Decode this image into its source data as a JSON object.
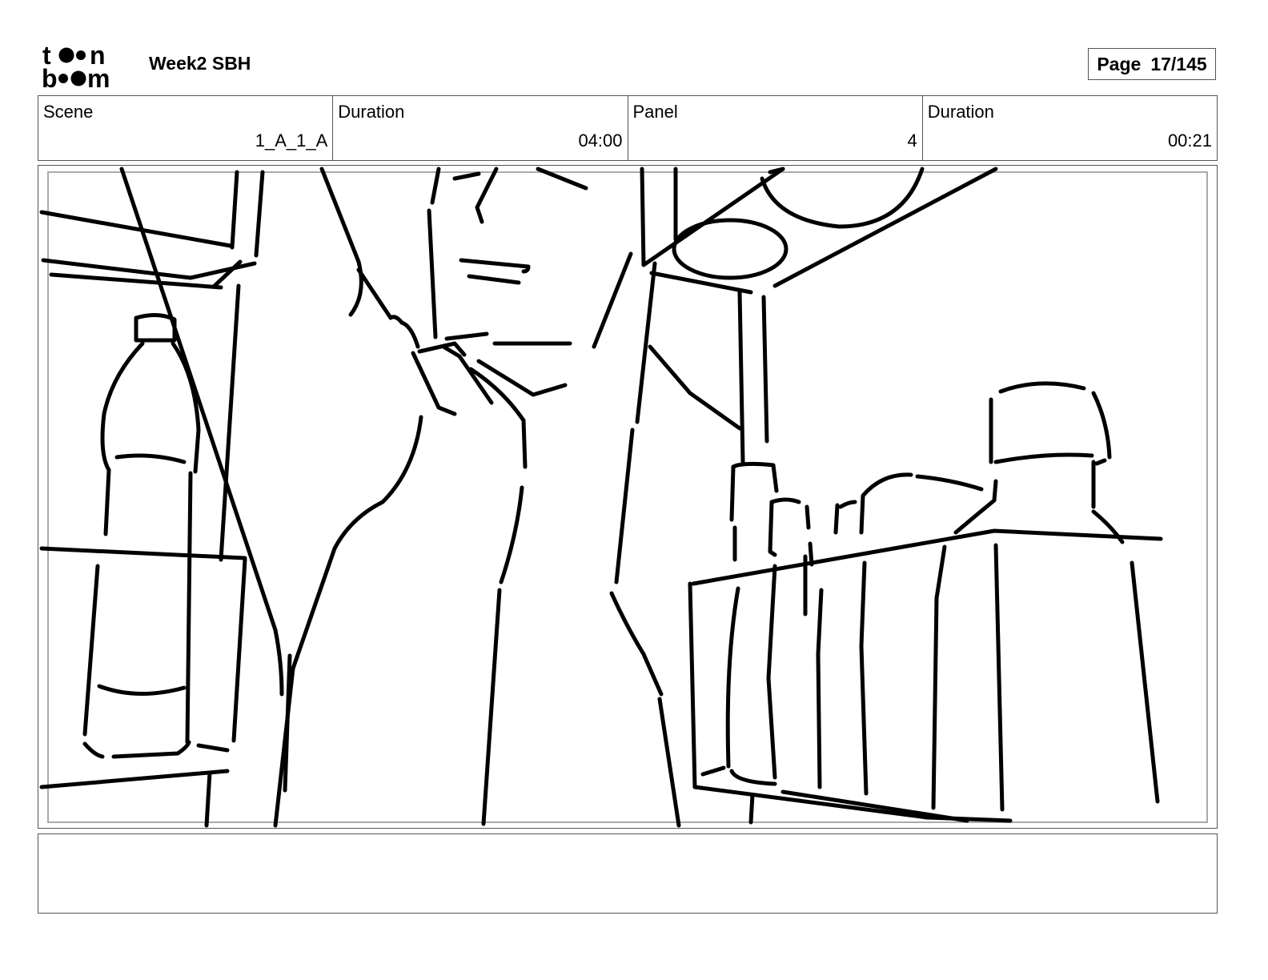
{
  "header": {
    "logo_text": "toon boom",
    "title": "Week2 SBH",
    "page_label": "Page",
    "page_value": "17/145"
  },
  "info": {
    "scene": {
      "label": "Scene",
      "value": "1_A_1_A"
    },
    "scene_duration": {
      "label": "Duration",
      "value": "04:00"
    },
    "panel": {
      "label": "Panel",
      "value": "4"
    },
    "panel_duration": {
      "label": "Duration",
      "value": "00:21"
    }
  },
  "panel_image": {
    "description_icon": "sketch-drawing"
  },
  "notes": {
    "text": ""
  }
}
